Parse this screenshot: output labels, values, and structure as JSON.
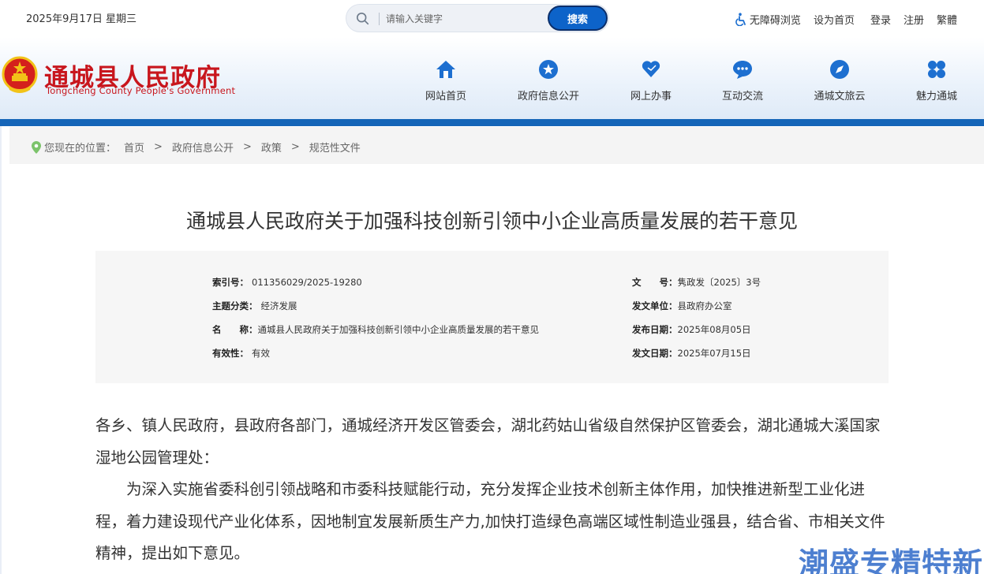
{
  "topbar": {
    "date": "2025年9月17日 星期三",
    "search": {
      "placeholder": "请输入关键字",
      "button": "搜索"
    },
    "links": {
      "accessibility": "无障碍浏览",
      "homepage": "设为首页",
      "login": "登录",
      "register": "注册",
      "traditional": "繁體"
    }
  },
  "header": {
    "title": "通城县人民政府",
    "subtitle": "Tongcheng County People's Government",
    "nav": [
      {
        "label": "网站首页",
        "icon": "home-icon"
      },
      {
        "label": "政府信息公开",
        "icon": "star-icon"
      },
      {
        "label": "网上办事",
        "icon": "heart-icon"
      },
      {
        "label": "互动交流",
        "icon": "chat-icon"
      },
      {
        "label": "通城文旅云",
        "icon": "compass-icon"
      },
      {
        "label": "魅力通城",
        "icon": "clover-icon"
      }
    ]
  },
  "breadcrumb": {
    "prefix": "您现在的位置：",
    "items": [
      "首页",
      "政府信息公开",
      "政策",
      "规范性文件"
    ]
  },
  "article": {
    "title": "通城县人民政府关于加强科技创新引领中小企业高质量发展的若干意见",
    "meta": {
      "index_label": "索引号：",
      "index": "011356029/2025-19280",
      "doc_no_label": "文　　号：",
      "doc_no": "隽政发〔2025〕3号",
      "category_label": "主题分类：",
      "category": "经济发展",
      "issuer_label": "发文单位：",
      "issuer": "县政府办公室",
      "name_label": "名　　称：",
      "name": "通城县人民政府关于加强科技创新引领中小企业高质量发展的若干意见",
      "publish_label": "发布日期：",
      "publish": "2025年08月05日",
      "validity_label": "有效性：",
      "validity": "有效",
      "issue_label": "发文日期：",
      "issue": "2025年07月15日"
    },
    "greeting": "各乡、镇人民政府，县政府各部门，通城经济开发区管委会，湖北药姑山省级自然保护区管委会，湖北通城大溪国家湿地公园管理处：",
    "paragraph1": "为深入实施省委科创引领战略和市委科技赋能行动，充分发挥企业技术创新主体作用，加快推进新型工业化进程，着力建设现代产业化体系，因地制宜发展新质生产力,加快打造绿色高端区域性制造业强县，结合省、市相关文件精神，提出如下意见。"
  },
  "watermark": "潮盛专精特新",
  "colors": {
    "brand_red": "#c8161d",
    "brand_blue": "#1565b8",
    "button_blue": "#0d63c9"
  }
}
